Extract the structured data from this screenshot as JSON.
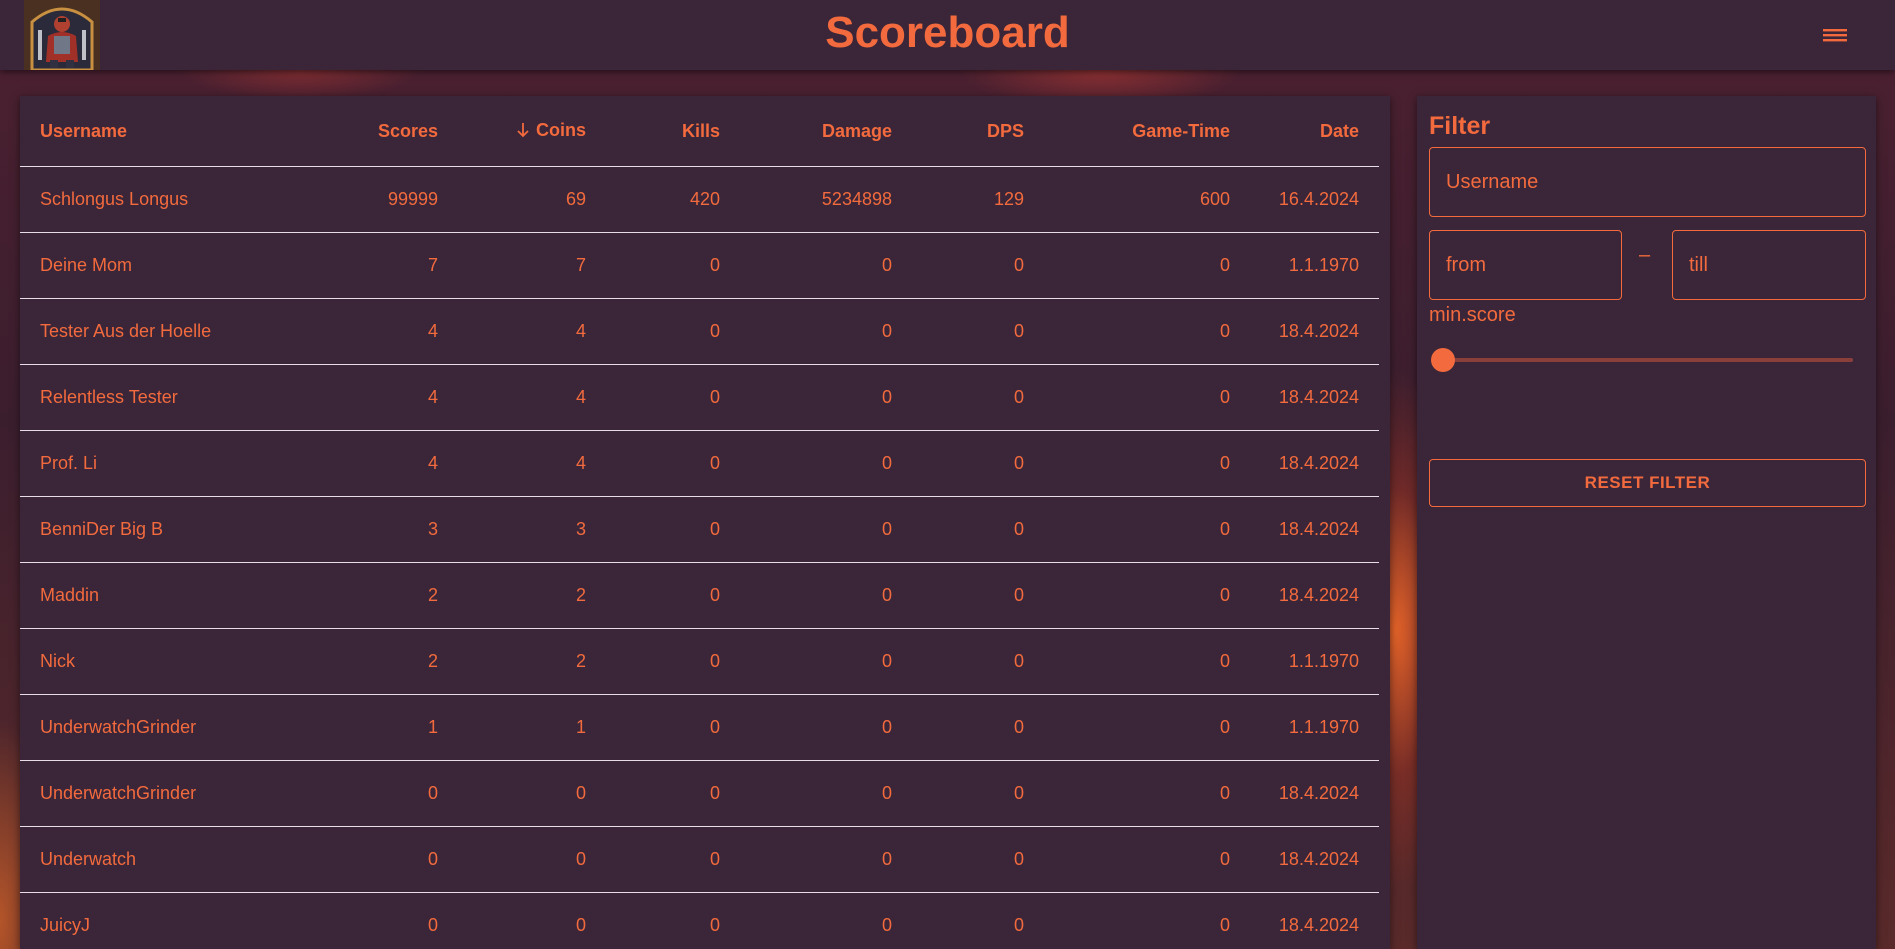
{
  "header": {
    "title": "Scoreboard",
    "logo_icon": "knight-portrait-icon",
    "menu_icon": "hamburger-menu-icon"
  },
  "table": {
    "columns": [
      "Username",
      "Scores",
      "Coins",
      "Kills",
      "Damage",
      "DPS",
      "Game-Time",
      "Date"
    ],
    "sorted_column": "Coins",
    "sort_direction": "descending",
    "rows": [
      [
        "Schlongus Longus",
        "99999",
        "69",
        "420",
        "5234898",
        "129",
        "600",
        "16.4.2024"
      ],
      [
        "Deine Mom",
        "7",
        "7",
        "0",
        "0",
        "0",
        "0",
        "1.1.1970"
      ],
      [
        "Tester Aus der Hoelle",
        "4",
        "4",
        "0",
        "0",
        "0",
        "0",
        "18.4.2024"
      ],
      [
        "Relentless Tester",
        "4",
        "4",
        "0",
        "0",
        "0",
        "0",
        "18.4.2024"
      ],
      [
        "Prof. Li",
        "4",
        "4",
        "0",
        "0",
        "0",
        "0",
        "18.4.2024"
      ],
      [
        "BenniDer Big B",
        "3",
        "3",
        "0",
        "0",
        "0",
        "0",
        "18.4.2024"
      ],
      [
        "Maddin",
        "2",
        "2",
        "0",
        "0",
        "0",
        "0",
        "18.4.2024"
      ],
      [
        "Nick",
        "2",
        "2",
        "0",
        "0",
        "0",
        "0",
        "1.1.1970"
      ],
      [
        "UnderwatchGrinder",
        "1",
        "1",
        "0",
        "0",
        "0",
        "0",
        "1.1.1970"
      ],
      [
        "UnderwatchGrinder",
        "0",
        "0",
        "0",
        "0",
        "0",
        "0",
        "18.4.2024"
      ],
      [
        "Underwatch",
        "0",
        "0",
        "0",
        "0",
        "0",
        "0",
        "18.4.2024"
      ],
      [
        "JuicyJ",
        "0",
        "0",
        "0",
        "0",
        "0",
        "0",
        "18.4.2024"
      ]
    ]
  },
  "filter": {
    "title": "Filter",
    "username_placeholder": "Username",
    "from_placeholder": "from",
    "till_placeholder": "till",
    "range_separator": "–",
    "slider_label": "min.score",
    "slider_value": 0,
    "reset_label": "RESET FILTER"
  },
  "colors": {
    "accent": "#f26a3d",
    "panel": "#3a2638",
    "divider": "#e8dce6"
  }
}
